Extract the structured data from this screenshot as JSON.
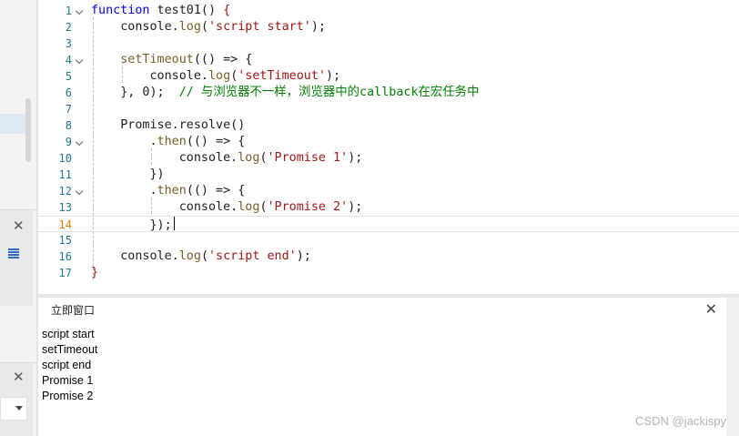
{
  "editor": {
    "current_line": 14,
    "lines": [
      {
        "n": "1",
        "fold": true,
        "tokens": [
          {
            "t": "k",
            "v": "function"
          },
          {
            "t": "",
            "v": " test01() "
          },
          {
            "t": "s",
            "v": "{"
          }
        ]
      },
      {
        "n": "2",
        "fold": false,
        "tokens": [
          {
            "t": "",
            "v": "    console."
          },
          {
            "t": "f",
            "v": "log"
          },
          {
            "t": "",
            "v": "("
          },
          {
            "t": "s",
            "v": "'script start'"
          },
          {
            "t": "",
            "v": ");"
          }
        ]
      },
      {
        "n": "3",
        "fold": false,
        "tokens": []
      },
      {
        "n": "4",
        "fold": true,
        "tokens": [
          {
            "t": "",
            "v": "    "
          },
          {
            "t": "f",
            "v": "setTimeout"
          },
          {
            "t": "",
            "v": "(() => {"
          }
        ]
      },
      {
        "n": "5",
        "fold": false,
        "tokens": [
          {
            "t": "",
            "v": "        console."
          },
          {
            "t": "f",
            "v": "log"
          },
          {
            "t": "",
            "v": "("
          },
          {
            "t": "s",
            "v": "'setTimeout'"
          },
          {
            "t": "",
            "v": ");"
          }
        ]
      },
      {
        "n": "6",
        "fold": false,
        "tokens": [
          {
            "t": "",
            "v": "    }, 0);  "
          },
          {
            "t": "c",
            "v": "// 与浏览器不一样，浏览器中的callback在宏任务中"
          }
        ]
      },
      {
        "n": "7",
        "fold": false,
        "tokens": []
      },
      {
        "n": "8",
        "fold": false,
        "tokens": [
          {
            "t": "",
            "v": "    Promise.resolve()"
          }
        ]
      },
      {
        "n": "9",
        "fold": true,
        "tokens": [
          {
            "t": "",
            "v": "        ."
          },
          {
            "t": "f",
            "v": "then"
          },
          {
            "t": "",
            "v": "(() => {"
          }
        ]
      },
      {
        "n": "10",
        "fold": false,
        "tokens": [
          {
            "t": "",
            "v": "            console."
          },
          {
            "t": "f",
            "v": "log"
          },
          {
            "t": "",
            "v": "("
          },
          {
            "t": "s",
            "v": "'Promise 1'"
          },
          {
            "t": "",
            "v": ");"
          }
        ]
      },
      {
        "n": "11",
        "fold": false,
        "tokens": [
          {
            "t": "",
            "v": "        })"
          }
        ]
      },
      {
        "n": "12",
        "fold": true,
        "tokens": [
          {
            "t": "",
            "v": "        ."
          },
          {
            "t": "f",
            "v": "then"
          },
          {
            "t": "",
            "v": "(() => {"
          }
        ]
      },
      {
        "n": "13",
        "fold": false,
        "tokens": [
          {
            "t": "",
            "v": "            console."
          },
          {
            "t": "f",
            "v": "log"
          },
          {
            "t": "",
            "v": "("
          },
          {
            "t": "s",
            "v": "'Promise 2'"
          },
          {
            "t": "",
            "v": ");"
          }
        ]
      },
      {
        "n": "14",
        "fold": false,
        "tokens": [
          {
            "t": "",
            "v": "        });"
          }
        ]
      },
      {
        "n": "15",
        "fold": false,
        "tokens": []
      },
      {
        "n": "16",
        "fold": false,
        "tokens": [
          {
            "t": "",
            "v": "    console."
          },
          {
            "t": "f",
            "v": "log"
          },
          {
            "t": "",
            "v": "("
          },
          {
            "t": "s",
            "v": "'script end'"
          },
          {
            "t": "",
            "v": ");"
          }
        ]
      },
      {
        "n": "17",
        "fold": false,
        "tokens": [
          {
            "t": "s",
            "v": "}"
          }
        ]
      }
    ]
  },
  "immediate": {
    "title": "立即窗口",
    "close_glyph": "✕",
    "output": [
      "script start",
      "setTimeout",
      "script end",
      "Promise 1",
      "Promise 2"
    ]
  },
  "sidebar": {
    "close_glyph": "✕"
  },
  "watermark": "CSDN @jackispy",
  "colors": {
    "keyword": "#0000ff",
    "function": "#795e26",
    "string": "#a31515",
    "comment": "#008000",
    "line_number": "#237893",
    "active_line_number": "#e07b00"
  },
  "icons": [
    "chevron-down-icon",
    "close-icon",
    "list-icon",
    "dropdown-arrow-icon"
  ]
}
